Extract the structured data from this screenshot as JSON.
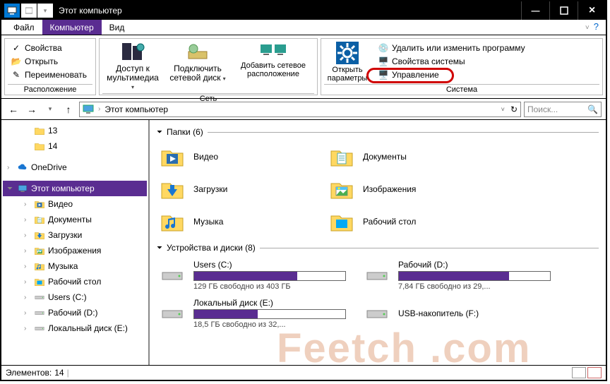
{
  "title": "Этот компьютер",
  "tabs": {
    "file": "Файл",
    "computer": "Компьютер",
    "view": "Вид"
  },
  "ribbon": {
    "location_group": "Расположение",
    "properties": "Свойства",
    "open": "Открыть",
    "rename": "Переименовать",
    "network_group": "Сеть",
    "media": "Доступ к мультимедиа",
    "map_drive": "Подключить сетевой диск",
    "add_net": "Добавить сетевое расположение",
    "system_group": "Система",
    "open_params": "Открыть параметры",
    "uninstall": "Удалить или изменить программу",
    "sys_props": "Свойства системы",
    "manage": "Управление"
  },
  "nav": {
    "back": "←",
    "forward": "→",
    "up": "↑",
    "path": "Этот компьютер",
    "search_ph": "Поиск..."
  },
  "tree": {
    "items": [
      {
        "label": "13",
        "icon": "folder",
        "sub": true
      },
      {
        "label": "14",
        "icon": "folder",
        "sub": true
      },
      {
        "label": "OneDrive",
        "icon": "cloud",
        "root": true
      },
      {
        "label": "Этот компьютер",
        "icon": "pc",
        "root": true,
        "active": true
      },
      {
        "label": "Видео",
        "icon": "video",
        "sub": true
      },
      {
        "label": "Документы",
        "icon": "doc",
        "sub": true
      },
      {
        "label": "Загрузки",
        "icon": "down",
        "sub": true
      },
      {
        "label": "Изображения",
        "icon": "img",
        "sub": true
      },
      {
        "label": "Музыка",
        "icon": "music",
        "sub": true
      },
      {
        "label": "Рабочий стол",
        "icon": "desk",
        "sub": true
      },
      {
        "label": "Users (C:)",
        "icon": "drive",
        "sub": true
      },
      {
        "label": "Рабочий (D:)",
        "icon": "drive",
        "sub": true
      },
      {
        "label": "Локальный диск (E:)",
        "icon": "drive",
        "sub": true
      }
    ]
  },
  "folders": {
    "header": "Папки (6)",
    "items": [
      {
        "label": "Видео",
        "icon": "video"
      },
      {
        "label": "Документы",
        "icon": "doc"
      },
      {
        "label": "Загрузки",
        "icon": "down"
      },
      {
        "label": "Изображения",
        "icon": "img"
      },
      {
        "label": "Музыка",
        "icon": "music"
      },
      {
        "label": "Рабочий стол",
        "icon": "desk"
      }
    ]
  },
  "drives": {
    "header": "Устройства и диски (8)",
    "items": [
      {
        "label": "Users (C:)",
        "free": "129 ГБ свободно из 403 ГБ",
        "pct": 68
      },
      {
        "label": "Рабочий (D:)",
        "free": "7,84 ГБ свободно из 29,...",
        "pct": 73
      },
      {
        "label": "Локальный диск (E:)",
        "free": "18,5 ГБ свободно из 32,...",
        "pct": 42
      },
      {
        "label": "USB-накопитель (F:)",
        "free": "",
        "pct": 0,
        "nobar": true
      }
    ]
  },
  "status": {
    "count_label": "Элементов:",
    "count": "14"
  }
}
